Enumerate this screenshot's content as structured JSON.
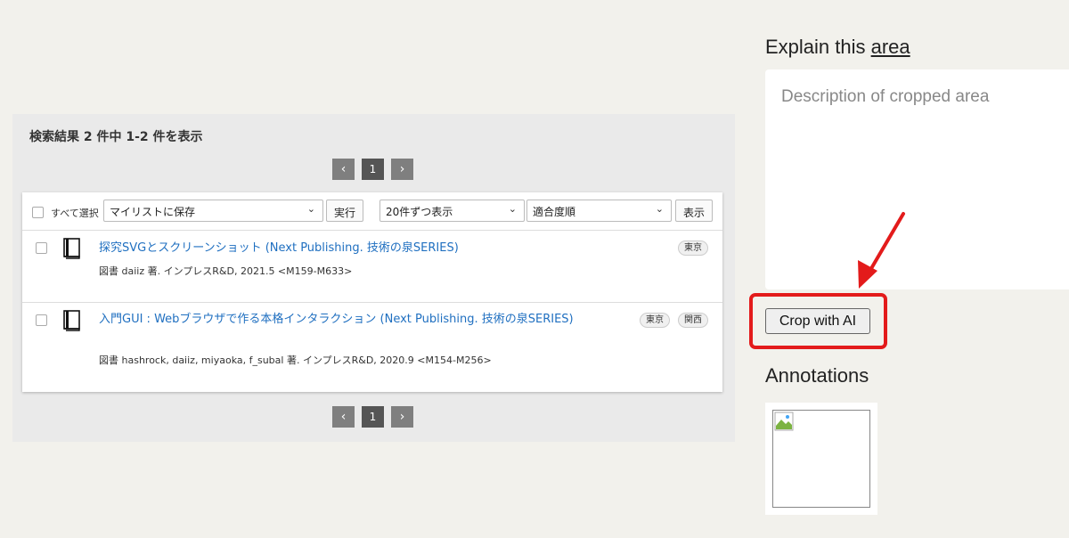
{
  "results": {
    "summary": "検索結果 2 件中 1-2 件を表示",
    "pager": {
      "prev": "‹",
      "current": "1",
      "next": "›"
    },
    "toolbar": {
      "select_all": "すべて選択",
      "mylist_select": "マイリストに保存",
      "run_button": "実行",
      "per_page_select": "20件ずつ表示",
      "sort_select": "適合度順",
      "show_button": "表示"
    },
    "items": [
      {
        "title": "探究SVGとスクリーンショット (Next Publishing. 技術の泉SERIES)",
        "meta": "図書 daiiz 著. インプレスR&D, 2021.5 <M159-M633>",
        "tags": [
          "東京"
        ]
      },
      {
        "title": "入門GUI : Webブラウザで作る本格インタラクション (Next Publishing. 技術の泉SERIES)",
        "meta": "図書 hashrock, daiiz, miyaoka, f_subal 著. インプレスR&D, 2020.9 <M154-M256>",
        "tags": [
          "東京",
          "関西"
        ]
      }
    ]
  },
  "side": {
    "explain_prefix": "Explain this ",
    "explain_link": "area",
    "description_placeholder": "Description of cropped area",
    "crop_button": "Crop with AI",
    "annotations_title": "Annotations",
    "highlight_color": "#e31b1b"
  }
}
